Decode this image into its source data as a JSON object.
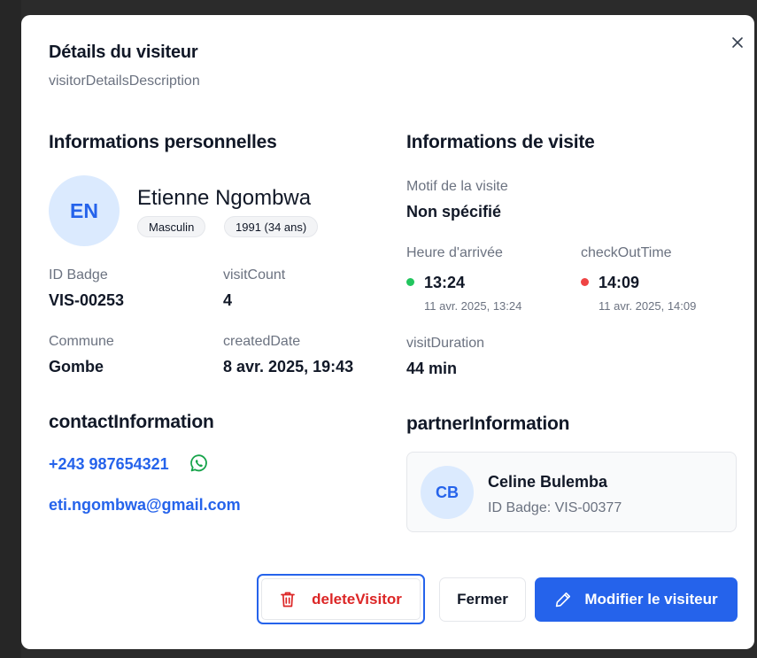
{
  "dialog": {
    "title": "Détails du visiteur",
    "description": "visitorDetailsDescription"
  },
  "personal": {
    "heading": "Informations personnelles",
    "initials": "EN",
    "name": "Etienne Ngombwa",
    "gender": "Masculin",
    "birth": "1991 (34 ans)",
    "badge_label": "ID Badge",
    "badge_value": "VIS-00253",
    "visit_count_label": "visitCount",
    "visit_count_value": "4",
    "commune_label": "Commune",
    "commune_value": "Gombe",
    "created_label": "createdDate",
    "created_value": "8 avr. 2025, 19:43"
  },
  "visit": {
    "heading": "Informations de visite",
    "purpose_label": "Motif de la visite",
    "purpose_value": "Non spécifié",
    "arrival_label": "Heure d'arrivée",
    "arrival_time": "13:24",
    "arrival_full": "11 avr. 2025, 13:24",
    "checkout_label": "checkOutTime",
    "checkout_time": "14:09",
    "checkout_full": "11 avr. 2025, 14:09",
    "duration_label": "visitDuration",
    "duration_value": "44 min"
  },
  "contact": {
    "heading": "contactInformation",
    "phone": "+243 987654321",
    "email": "eti.ngombwa@gmail.com"
  },
  "partner": {
    "heading": "partnerInformation",
    "initials": "CB",
    "name": "Celine Bulemba",
    "badge": "ID Badge: VIS-00377"
  },
  "actions": {
    "delete_label": "deleteVisitor",
    "close_label": "Fermer",
    "edit_label": "Modifier le visiteur"
  },
  "colors": {
    "accent": "#2563eb",
    "danger": "#dc2626",
    "success": "#22c55e",
    "whatsapp": "#16a34a"
  }
}
